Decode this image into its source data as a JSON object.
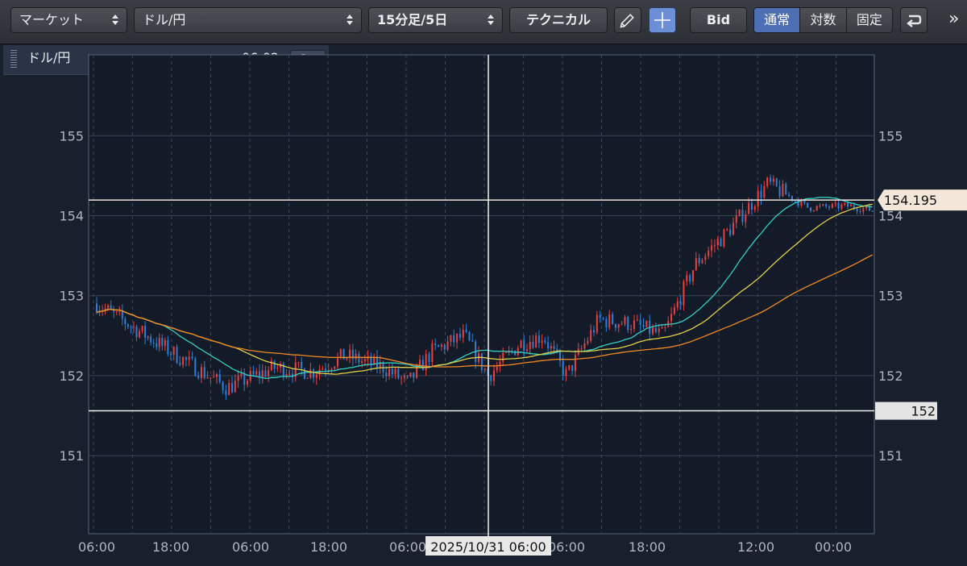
{
  "toolbar": {
    "market_select": "マーケット",
    "pair_select": "ドル/円",
    "timeframe_select": "15分足/5日",
    "technical_button": "テクニカル",
    "bid_button": "Bid",
    "scale_options": [
      "通常",
      "対数",
      "固定"
    ],
    "scale_active": "通常",
    "more_glyph": "»"
  },
  "panel": {
    "pair": "ドル/円",
    "time": "06:02",
    "info_glyph": "i"
  },
  "icons": [
    "pencil-icon",
    "crosshair-icon",
    "undo-icon",
    "info-icon",
    "more-chevron-icon"
  ],
  "colors": {
    "background": "#18202d",
    "plot_background": "#141b28",
    "grid": "#3a4456",
    "up_candle": "#e8413f",
    "down_candle": "#2f7fd6",
    "ma_short": "#33cfc2",
    "ma_mid": "#e0d148",
    "ma_long": "#f08a24",
    "price_tag": "#f2e7d8",
    "cursor_tag": "#e4e4e4",
    "crosshair_btn": "#6d8fd6"
  },
  "chart_data": {
    "type": "candlestick",
    "title": "ドル/円",
    "ylim": [
      150,
      156
    ],
    "y_ticks": [
      151,
      152,
      153,
      154,
      155
    ],
    "x_ticks": [
      "06:00",
      "18:00",
      "06:00",
      "18:00",
      "06:00",
      "18:00",
      "06:00",
      "18:00",
      "12:00",
      "00:00"
    ],
    "grid": true,
    "last_price": "154.195",
    "crosshair": {
      "price_label": "152",
      "price": 151.56,
      "time_label": "2025/10/31 06:00",
      "time_index": 5
    },
    "series": [
      {
        "name": "",
        "type": "candle",
        "anchors": [
          [
            0,
            152.9
          ],
          [
            1,
            152.3
          ],
          [
            1.7,
            151.85
          ],
          [
            2.3,
            152.1
          ],
          [
            2.8,
            152.05
          ],
          [
            3.2,
            152.25
          ],
          [
            3.7,
            152.1
          ],
          [
            4,
            151.9
          ],
          [
            4.3,
            152.3
          ],
          [
            4.7,
            152.5
          ],
          [
            5,
            152.0
          ],
          [
            5.4,
            152.4
          ],
          [
            5.7,
            152.5
          ],
          [
            6,
            152.0
          ],
          [
            6.4,
            152.7
          ],
          [
            6.8,
            152.65
          ],
          [
            7.2,
            152.5
          ],
          [
            7.6,
            153.4
          ],
          [
            8,
            153.8
          ],
          [
            8.5,
            154.4
          ],
          [
            9,
            154.1
          ],
          [
            9.5,
            154.12
          ],
          [
            9.9,
            154.05
          ],
          [
            10.3,
            153.75
          ],
          [
            10.7,
            153.95
          ],
          [
            11,
            154.3
          ],
          [
            11.3,
            154.15
          ],
          [
            11.7,
            154.12
          ],
          [
            12.2,
            154.08
          ],
          [
            12.8,
            154.14
          ],
          [
            13.4,
            154.1
          ],
          [
            13.9,
            154.2
          ],
          [
            14.4,
            154.15
          ],
          [
            15,
            154.2
          ],
          [
            15.6,
            154.18
          ],
          [
            16.1,
            154.2
          ]
        ]
      },
      {
        "name": "",
        "type": "ma",
        "window": 4
      },
      {
        "name": "",
        "type": "ma",
        "window": 8
      },
      {
        "name": "",
        "type": "ma",
        "window": 16
      }
    ]
  }
}
